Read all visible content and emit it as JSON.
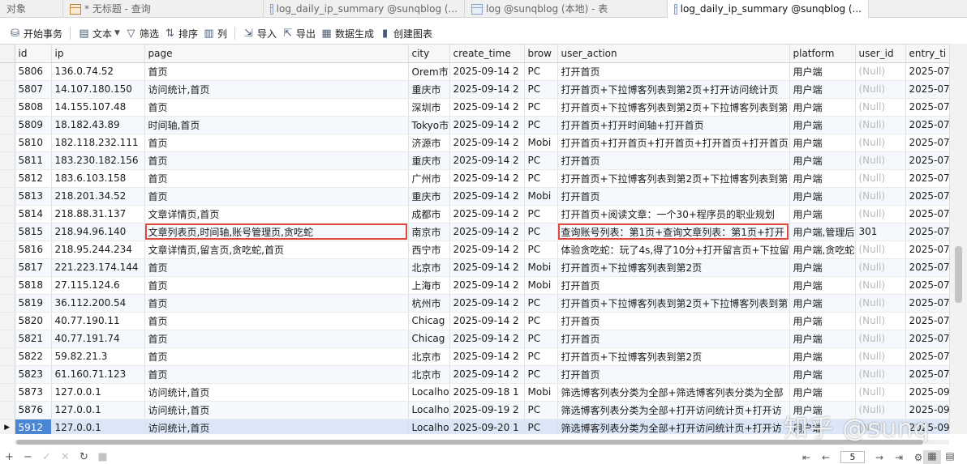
{
  "tabs": [
    {
      "label": "对象",
      "icon": "",
      "active": false
    },
    {
      "label": "* 无标题 - 查询",
      "icon": "query-icon",
      "active": false
    },
    {
      "label": "log_daily_ip_summary @sunqblog (...",
      "icon": "table-icon",
      "active": false
    },
    {
      "label": "log @sunqblog (本地) - 表",
      "icon": "table-icon",
      "active": false
    },
    {
      "label": "log_daily_ip_summary @sunqblog (...",
      "icon": "table-icon",
      "active": true
    }
  ],
  "toolbar": {
    "begin_transaction": "开始事务",
    "text": "文本",
    "filter": "筛选",
    "sort": "排序",
    "columns": "列",
    "import": "导入",
    "export": "导出",
    "data_generation": "数据生成",
    "create_chart": "创建图表"
  },
  "columns": [
    "id",
    "ip",
    "page",
    "city",
    "create_time",
    "brow",
    "user_action",
    "platform",
    "user_id",
    "entry_ti"
  ],
  "rows": [
    [
      "5806",
      "136.0.74.52",
      "首页",
      "Orem市",
      "2025-09-14 2",
      "PC",
      "打开首页",
      "用户端",
      "(Null)",
      "2025-07-"
    ],
    [
      "5807",
      "14.107.180.150",
      "访问统计,首页",
      "重庆市",
      "2025-09-14 2",
      "PC",
      "打开首页+下拉博客列表到第2页+打开访问统计页",
      "用户端",
      "(Null)",
      "2025-07-"
    ],
    [
      "5808",
      "14.155.107.48",
      "首页",
      "深圳市",
      "2025-09-14 2",
      "PC",
      "打开首页+下拉博客列表到第2页+下拉博客列表到第",
      "用户端",
      "(Null)",
      "2025-07-"
    ],
    [
      "5809",
      "18.182.43.89",
      "时间轴,首页",
      "Tokyo市",
      "2025-09-14 2",
      "PC",
      "打开首页+打开时间轴+打开首页",
      "用户端",
      "(Null)",
      "2025-07-"
    ],
    [
      "5810",
      "182.118.232.111",
      "首页",
      "济源市",
      "2025-09-14 2",
      "Mobi",
      "打开首页+打开首页+打开首页+打开首页+打开首页",
      "用户端",
      "(Null)",
      "2025-07-"
    ],
    [
      "5811",
      "183.230.182.156",
      "首页",
      "重庆市",
      "2025-09-14 2",
      "PC",
      "打开首页",
      "用户端",
      "(Null)",
      "2025-07-"
    ],
    [
      "5812",
      "183.6.103.158",
      "首页",
      "广州市",
      "2025-09-14 2",
      "PC",
      "打开首页+下拉博客列表到第2页+下拉博客列表到第",
      "用户端",
      "(Null)",
      "2025-07-"
    ],
    [
      "5813",
      "218.201.34.52",
      "首页",
      "重庆市",
      "2025-09-14 2",
      "Mobi",
      "打开首页",
      "用户端",
      "(Null)",
      "2025-07-"
    ],
    [
      "5814",
      "218.88.31.137",
      "文章详情页,首页",
      "成都市",
      "2025-09-14 2",
      "PC",
      "打开首页+阅读文章：一个30+程序员的职业规划",
      "用户端",
      "(Null)",
      "2025-07-"
    ],
    [
      "5815",
      "218.94.96.140",
      "文章列表页,时间轴,账号管理页,贪吃蛇",
      "南京市",
      "2025-09-14 2",
      "PC",
      "查询账号列表：第1页+查询文章列表：第1页+打开",
      "用户端,管理后",
      "301",
      "2025-07-"
    ],
    [
      "5816",
      "218.95.244.234",
      "文章详情页,留言页,贪吃蛇,首页",
      "西宁市",
      "2025-09-14 2",
      "PC",
      "体验贪吃蛇：玩了4s,得了10分+打开留言页+下拉留",
      "用户端,贪吃蛇",
      "(Null)",
      "2025-07-"
    ],
    [
      "5817",
      "221.223.174.144",
      "首页",
      "北京市",
      "2025-09-14 2",
      "Mobi",
      "打开首页+下拉博客列表到第2页",
      "用户端",
      "(Null)",
      "2025-07-"
    ],
    [
      "5818",
      "27.115.124.6",
      "首页",
      "上海市",
      "2025-09-14 2",
      "Mobi",
      "打开首页",
      "用户端",
      "(Null)",
      "2025-07-"
    ],
    [
      "5819",
      "36.112.200.54",
      "首页",
      "杭州市",
      "2025-09-14 2",
      "PC",
      "打开首页+下拉博客列表到第2页+下拉博客列表到第",
      "用户端",
      "(Null)",
      "2025-07-"
    ],
    [
      "5820",
      "40.77.190.11",
      "首页",
      "Chicag",
      "2025-09-14 2",
      "PC",
      "打开首页",
      "用户端",
      "(Null)",
      "2025-07-"
    ],
    [
      "5821",
      "40.77.191.74",
      "首页",
      "Chicag",
      "2025-09-14 2",
      "PC",
      "打开首页",
      "用户端",
      "(Null)",
      "2025-07-"
    ],
    [
      "5822",
      "59.82.21.3",
      "首页",
      "北京市",
      "2025-09-14 2",
      "PC",
      "打开首页+下拉博客列表到第2页",
      "用户端",
      "(Null)",
      "2025-07-"
    ],
    [
      "5823",
      "61.160.71.123",
      "首页",
      "北京市",
      "2025-09-14 2",
      "PC",
      "打开首页",
      "用户端",
      "(Null)",
      "2025-07-"
    ],
    [
      "5873",
      "127.0.0.1",
      "访问统计,首页",
      "Localho",
      "2025-09-18 1",
      "Mobi",
      "筛选博客列表分类为全部+筛选博客列表分类为全部",
      "用户端",
      "(Null)",
      "2025-09-"
    ],
    [
      "5876",
      "127.0.0.1",
      "访问统计,首页",
      "Localho",
      "2025-09-19 2",
      "PC",
      "筛选博客列表分类为全部+打开访问统计页+打开访",
      "用户端",
      "(Null)",
      "2025-09-"
    ],
    [
      "5912",
      "127.0.0.1",
      "访问统计,首页",
      "Localho",
      "2025-09-20 1",
      "PC",
      "筛选博客列表分类为全部+打开访问统计页+打开访",
      "用户端",
      "(Null)",
      "2025-09-"
    ]
  ],
  "pagination": {
    "page": "5"
  },
  "watermark": "知乎 @sunq"
}
